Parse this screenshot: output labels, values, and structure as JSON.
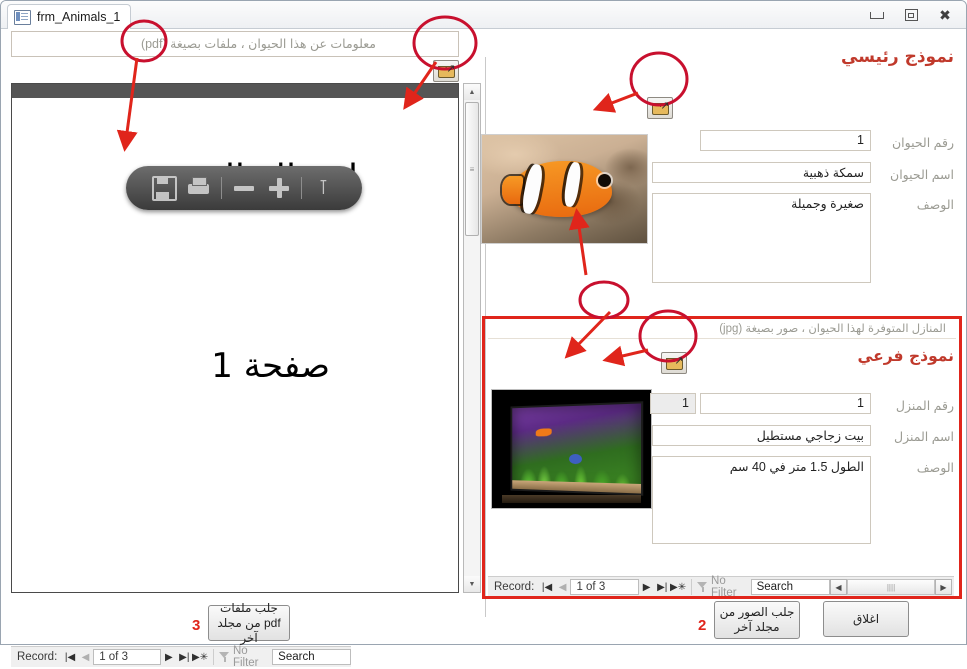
{
  "window": {
    "tab_title": "frm_Animals_1",
    "form_icon": "access-form-icon",
    "minimize": "minimize-icon",
    "restore": "restore-icon",
    "close": "close-icon"
  },
  "pdf_pane": {
    "header_text": "معلومات عن هذا الحيوان ، ملفات بصيغة (pdf)",
    "browse_icon": "open-folder-icon",
    "document": {
      "title": "اسماك الزينة",
      "page_label": "صفحة 1"
    },
    "toolbar": {
      "save_icon": "save-icon",
      "print_icon": "print-icon",
      "zoom_out_icon": "zoom-out-icon",
      "zoom_in_icon": "zoom-in-icon",
      "adobe_icon": "adobe-reader-icon"
    },
    "scrollbar": {
      "up_arrow": "▲",
      "down_arrow": "▼",
      "grip": "≡"
    }
  },
  "main_form": {
    "title": "نموذج رئيسي",
    "browse_icon": "open-folder-icon",
    "picture_alt": "clownfish-photo",
    "fields": [
      {
        "label": "رقم الحيوان",
        "value": "1"
      },
      {
        "label": "اسم الحيوان",
        "value": "سمكة ذهبية"
      },
      {
        "label": "الوصف",
        "value": "صغيرة وجميلة"
      }
    ]
  },
  "subform": {
    "header_text": "المنازل المتوفرة لهذا الحيوان ، صور بصيغة (jpg)",
    "title": "نموذج فرعي",
    "browse_icon": "open-folder-icon",
    "picture_alt": "aquarium-photo",
    "fields": [
      {
        "label": "رقم المنزل",
        "value": "1",
        "secondary_value": "1"
      },
      {
        "label": "اسم المنزل",
        "value": "بيت زجاجي مستطيل"
      },
      {
        "label": "الوصف",
        "value": "الطول 1.5 متر في 40 سم"
      }
    ]
  },
  "record_nav_main": {
    "label": "Record:",
    "first": "|◀",
    "previous": "◀",
    "position": "1 of 3",
    "next": "▶",
    "last": "▶|",
    "new": "▶✳",
    "filter": "No Filter",
    "search": "Search"
  },
  "record_nav_sub": {
    "label": "Record:",
    "first": "|◀",
    "previous": "◀",
    "position": "1 of 3",
    "next": "▶",
    "last": "▶|",
    "new": "▶✳",
    "filter": "No Filter",
    "search": "Search",
    "hscroll_left": "◀",
    "hscroll_right": "▶",
    "hscroll_grip": "||||"
  },
  "buttons": {
    "close": "اغلاق",
    "get_images": "جلب الصور من مجلد آخر",
    "get_pdf": "جلب ملفات pdf من مجلد آخر"
  },
  "annotations": {
    "number_2": "2",
    "number_3": "3",
    "accent_color": "#e0251b",
    "title_color": "#c0392b"
  }
}
